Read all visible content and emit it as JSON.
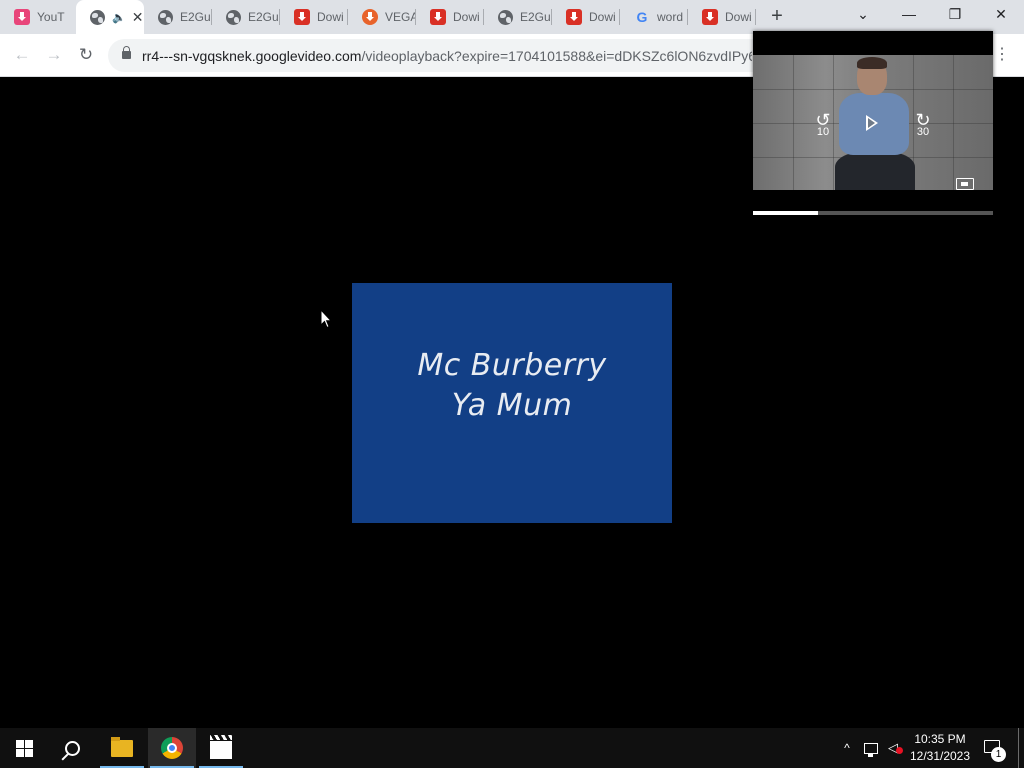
{
  "browser": {
    "tabs": [
      {
        "title": "YouT",
        "favicon": "youtube-download-icon",
        "active": false
      },
      {
        "title": "",
        "favicon": "globe-icon",
        "active": true,
        "audio_icon": "🔈",
        "close_icon": "✕"
      },
      {
        "title": "E2Gu",
        "favicon": "globe-icon",
        "active": false
      },
      {
        "title": "E2Gu",
        "favicon": "globe-icon",
        "active": false
      },
      {
        "title": "Dowi",
        "favicon": "download-icon",
        "active": false
      },
      {
        "title": "VEGA",
        "favicon": "orange-download-icon",
        "active": false
      },
      {
        "title": "Dowi",
        "favicon": "download-icon",
        "active": false
      },
      {
        "title": "E2Gu",
        "favicon": "globe-icon",
        "active": false
      },
      {
        "title": "Dowi",
        "favicon": "download-icon",
        "active": false
      },
      {
        "title": "word",
        "favicon": "google-icon",
        "active": false
      },
      {
        "title": "Dowi",
        "favicon": "download-icon",
        "active": false
      }
    ],
    "new_tab": "+",
    "tab_search": "⌄",
    "window_controls": {
      "minimize": "—",
      "restore": "❐",
      "close": "✕"
    },
    "nav": {
      "back": "←",
      "forward": "→",
      "reload": "↻",
      "menu": "⋮"
    },
    "url_host": "rr4---sn-vgqsknek.googlevideo.com",
    "url_path": "/videoplayback?expire=1704101588&ei=dDKSZc6lON6zvdIPy6"
  },
  "video": {
    "line1": "Mc Burberry",
    "line2": "Ya Mum",
    "background": "#123f86"
  },
  "pip": {
    "rewind_label": "10",
    "forward_label": "30",
    "progress": 0.27
  },
  "taskbar": {
    "time": "10:35 PM",
    "date": "12/31/2023",
    "notification_count": "1",
    "tray_chevron": "^"
  }
}
